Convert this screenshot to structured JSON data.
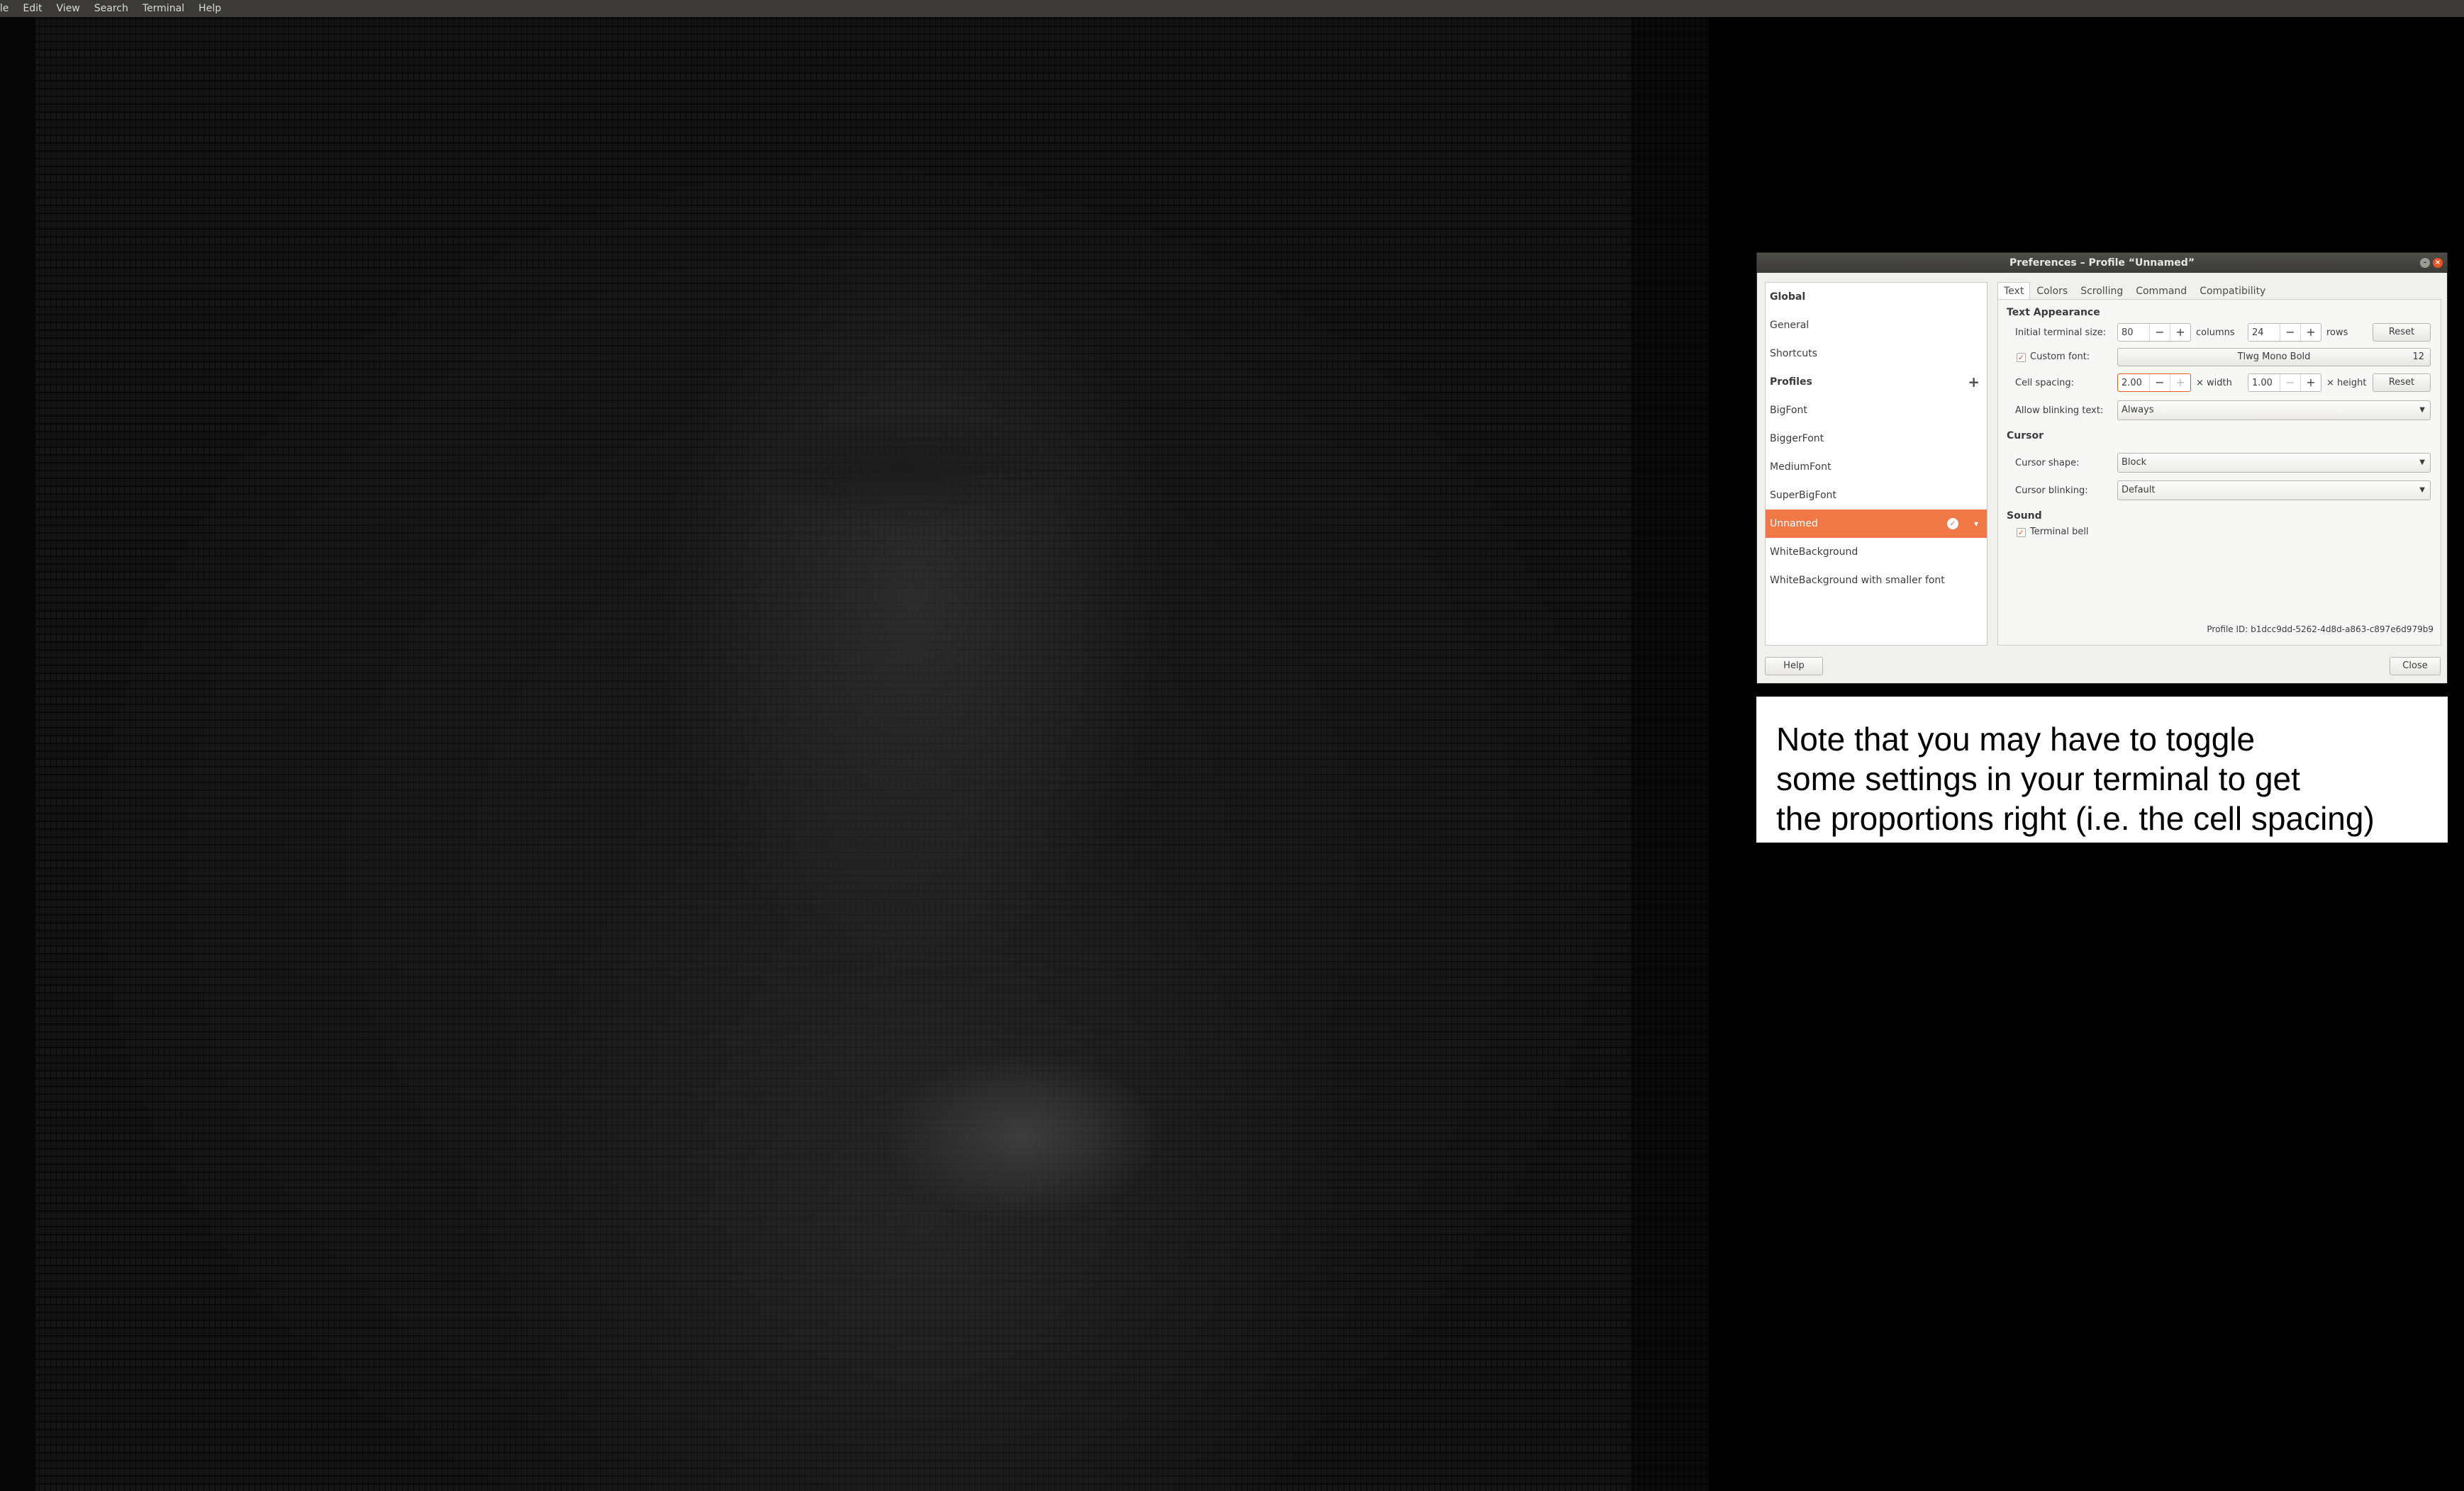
{
  "menubar": {
    "items": [
      "ile",
      "Edit",
      "View",
      "Search",
      "Terminal",
      "Help"
    ]
  },
  "dialog": {
    "title": "Preferences – Profile “Unnamed”",
    "sidebar": {
      "global_header": "Global",
      "general": "General",
      "shortcuts": "Shortcuts",
      "profiles_header": "Profiles",
      "add_icon": "+",
      "profiles": [
        "BigFont",
        "BiggerFont",
        "MediumFont",
        "SuperBigFont",
        "Unnamed",
        "WhiteBackground",
        "WhiteBackground with smaller font"
      ],
      "selected_profile": "Unnamed"
    },
    "tabs": [
      "Text",
      "Colors",
      "Scrolling",
      "Command",
      "Compatibility"
    ],
    "active_tab": "Text",
    "text_appearance": {
      "heading": "Text Appearance",
      "initial_size_label": "Initial terminal size:",
      "columns_value": "80",
      "columns_label": "columns",
      "rows_value": "24",
      "rows_label": "rows",
      "reset_label": "Reset",
      "custom_font_label": "Custom font:",
      "custom_font_checked": true,
      "font_name": "Tlwg Mono Bold",
      "font_size": "12",
      "cell_spacing_label": "Cell spacing:",
      "cell_width_value": "2.00",
      "width_label": "× width",
      "cell_height_value": "1.00",
      "height_label": "× height",
      "reset2_label": "Reset",
      "blink_label": "Allow blinking text:",
      "blink_value": "Always"
    },
    "cursor": {
      "heading": "Cursor",
      "shape_label": "Cursor shape:",
      "shape_value": "Block",
      "blinking_label": "Cursor blinking:",
      "blinking_value": "Default"
    },
    "sound": {
      "heading": "Sound",
      "bell_label": "Terminal bell",
      "bell_checked": true
    },
    "profile_id": "Profile ID:  b1dcc9dd-5262-4d8d-a863-c897e6d979b9",
    "help_label": "Help",
    "close_label": "Close"
  },
  "note": {
    "lines": [
      "Note that you may have to toggle",
      "some settings in your terminal to get",
      "the proportions right (i.e. the cell spacing)"
    ]
  },
  "colors": {
    "accent": "#f07746",
    "titlebar": "#3c3b37",
    "close_button": "#e95420"
  }
}
